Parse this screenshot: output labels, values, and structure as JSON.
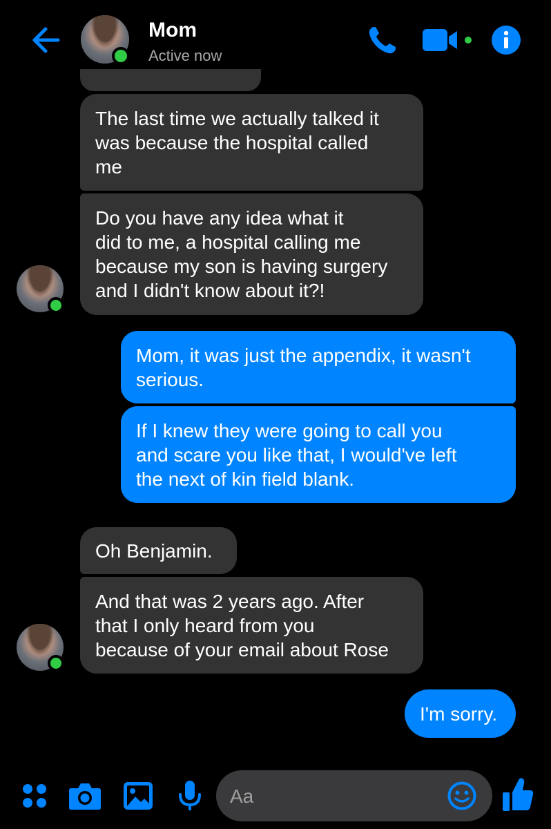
{
  "header": {
    "contact_name": "Mom",
    "status": "Active now"
  },
  "messages": [
    {
      "sender": "mom",
      "text": "The last time we actually talked it\nwas because the hospital called\nme"
    },
    {
      "sender": "mom",
      "text": "Do you have any idea what it\ndid to me, a hospital calling me\nbecause my son is having surgery\nand I didn't know about it?!"
    },
    {
      "sender": "me",
      "text": "Mom, it was just the appendix, it wasn't\nserious."
    },
    {
      "sender": "me",
      "text": "If I knew they were going to call you\nand scare you like that, I would've left\nthe next of kin field blank."
    },
    {
      "sender": "mom",
      "text": "Oh Benjamin."
    },
    {
      "sender": "mom",
      "text": "And that was 2 years ago. After\nthat  I only heard from you\nbecause of your email about Rose"
    },
    {
      "sender": "me",
      "text": "I'm sorry."
    }
  ],
  "composer": {
    "placeholder": "Aa"
  },
  "colors": {
    "accent": "#0084ff",
    "incoming_bubble": "#333333",
    "presence": "#31cc46",
    "background": "#000000"
  },
  "icons": [
    "back-arrow-icon",
    "phone-icon",
    "video-camera-icon",
    "info-icon",
    "menu-dots-icon",
    "camera-icon",
    "gallery-icon",
    "microphone-icon",
    "emoji-icon",
    "thumbs-up-icon"
  ]
}
